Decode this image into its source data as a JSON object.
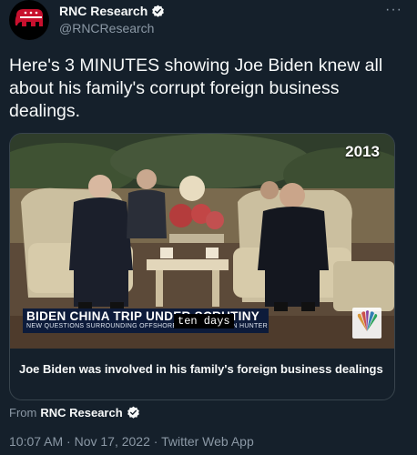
{
  "header": {
    "display_name": "RNC Research",
    "handle": "@RNCResearch",
    "more_label": "···"
  },
  "tweet": {
    "text": "Here's 3 MINUTES showing Joe Biden knew all about his family's corrupt foreign business dealings."
  },
  "card": {
    "year_overlay": "2013",
    "banner_title": "BIDEN CHINA TRIP UNDER SCRUTINY",
    "banner_subtitle": "NEW QUESTIONS SURROUNDING OFFSHORE DEALS WITH SON HUNTER",
    "caption": "ten days",
    "title": "Joe Biden was involved in his family's foreign business dealings"
  },
  "footer": {
    "from_prefix": "From",
    "from_name": "RNC Research",
    "timestamp": "10:07 AM · Nov 17, 2022 · Twitter Web App"
  },
  "colors": {
    "background": "#15202b",
    "text_primary": "#f7f9f9",
    "text_secondary": "#8b98a5",
    "verified": "#1d9bf0",
    "logo_red": "#c8102e"
  },
  "icons": {
    "avatar": "republican-elephant-logo",
    "verified": "verified-badge-icon",
    "more": "more-options-icon"
  }
}
